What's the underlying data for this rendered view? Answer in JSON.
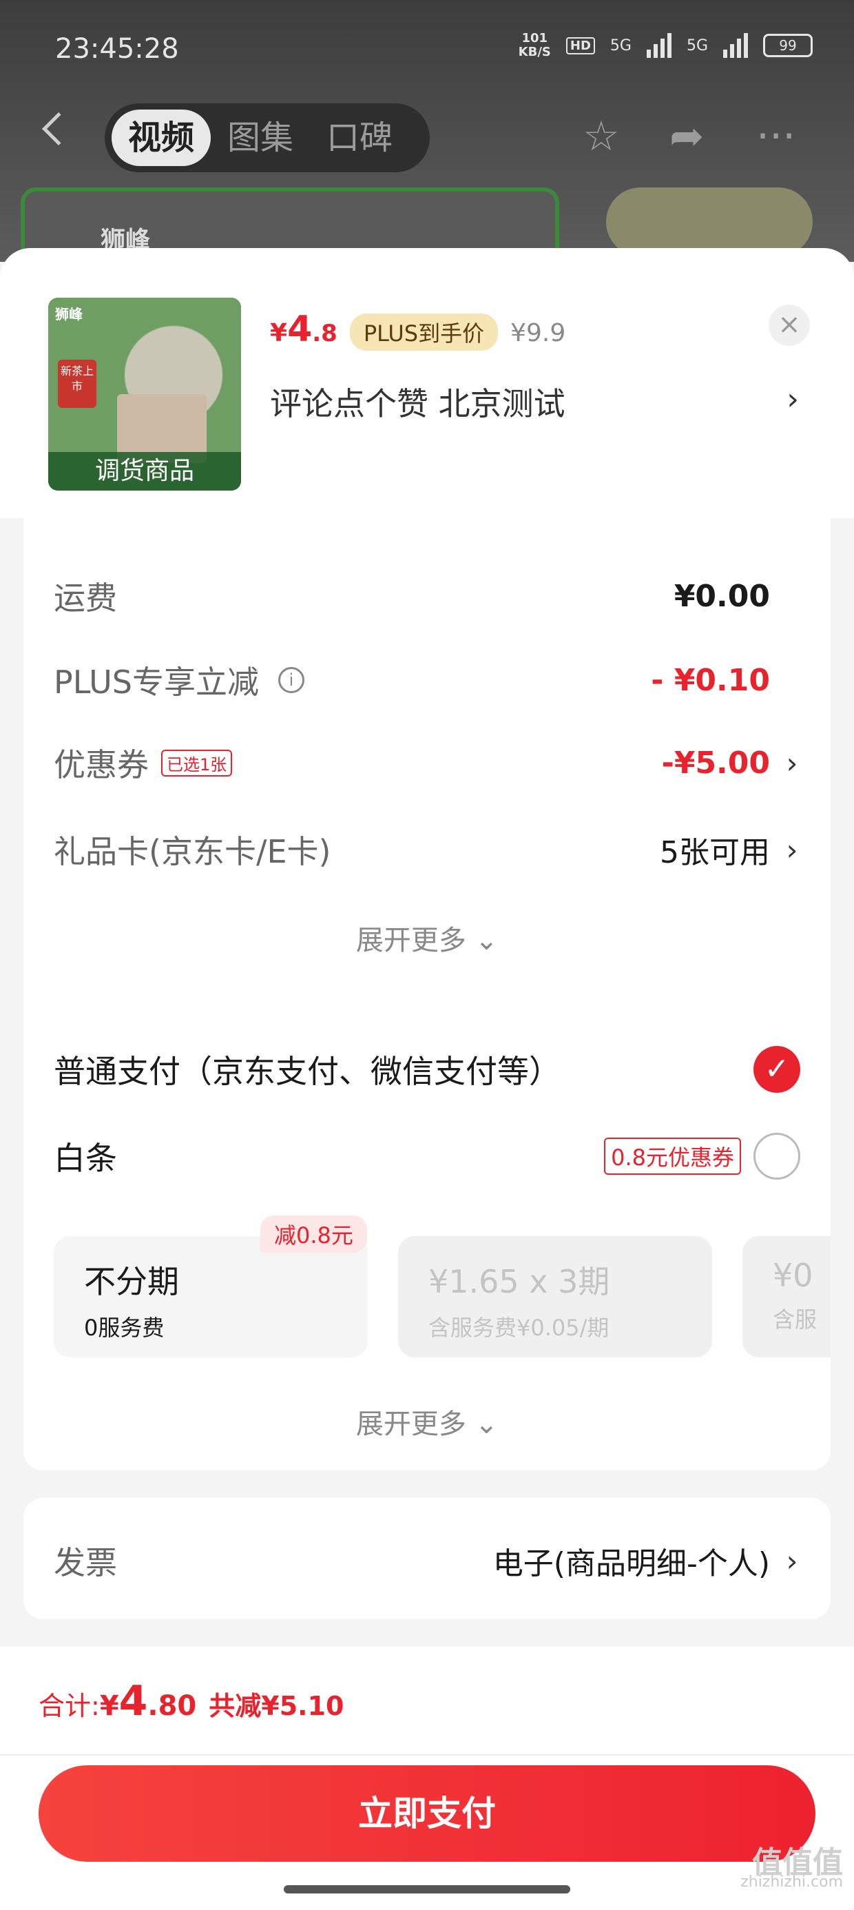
{
  "status_bar": {
    "time": "23:45:28",
    "net_speed": "101",
    "net_unit": "KB/S",
    "hd": "HD",
    "signal1": "5G",
    "signal2": "5G",
    "battery": "99"
  },
  "top_nav": {
    "tabs": [
      {
        "label": "视频"
      },
      {
        "label": "图集"
      },
      {
        "label": "口碑"
      }
    ],
    "brand": "狮峰"
  },
  "product": {
    "thumb_brand": "狮峰",
    "thumb_tag": "新茶上市",
    "thumb_caption": "调货商品",
    "price_symbol": "¥",
    "price_int": "4",
    "price_dec": ".8",
    "plus_tag": "PLUS到手价",
    "orig_price": "¥9.9",
    "spec": "评论点个赞  北京测试",
    "close_icon": "×",
    "spec_arrow": "›"
  },
  "fees": {
    "shipping": {
      "label": "运费",
      "value": "¥0.00"
    },
    "plus": {
      "label": "PLUS专享立减",
      "info": "i",
      "value": "- ¥0.10"
    },
    "coupon": {
      "label": "优惠券",
      "tag": "已选1张",
      "value": "-¥5.00"
    },
    "giftcard": {
      "label": "礼品卡(京东卡/E卡)",
      "value": "5张可用"
    },
    "expand": "展开更多 ⌄"
  },
  "payment": {
    "normal": {
      "label": "普通支付（京东支付、微信支付等）"
    },
    "baitiao": {
      "label": "白条",
      "coupon": "0.8元优惠券"
    },
    "reduce_tag": "减0.8元",
    "options": [
      {
        "title": "不分期",
        "sub": "0服务费"
      },
      {
        "title": "¥1.65 x 3期",
        "sub": "含服务费¥0.05/期"
      },
      {
        "title": "¥0",
        "sub": "含服"
      }
    ],
    "expand": "展开更多 ⌄"
  },
  "invoice": {
    "label": "发票",
    "value": "电子(商品明细-个人)"
  },
  "footer": {
    "total_label": "合计: ",
    "total_symbol": "¥",
    "total_int": "4",
    "total_dec": ".80",
    "saved": "共减¥5.10",
    "pay_button": "立即支付",
    "watermark_big": "值值值",
    "watermark_url": "zhizhizhi.com"
  },
  "colors": {
    "accent": "#e8232d",
    "plus_bg": "#f6e5b5"
  }
}
